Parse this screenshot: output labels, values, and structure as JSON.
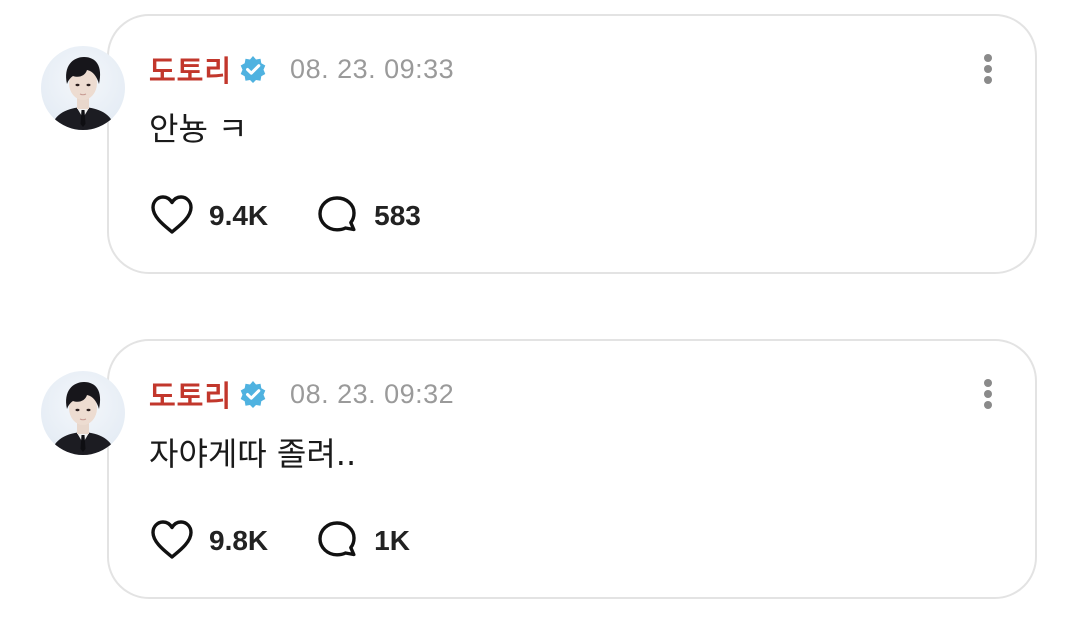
{
  "colors": {
    "name": "#c2372c",
    "verified": "#4fb2e0",
    "time": "#9a9a9a"
  },
  "posts": [
    {
      "author": "도토리",
      "verified_icon": "verified-badge-icon",
      "time": "08. 23. 09:33",
      "text": "안뇽 ㅋ",
      "likes": "9.4K",
      "comments": "583"
    },
    {
      "author": "도토리",
      "verified_icon": "verified-badge-icon",
      "time": "08. 23. 09:32",
      "text": "자야게따 졸려..",
      "likes": "9.8K",
      "comments": "1K"
    }
  ]
}
